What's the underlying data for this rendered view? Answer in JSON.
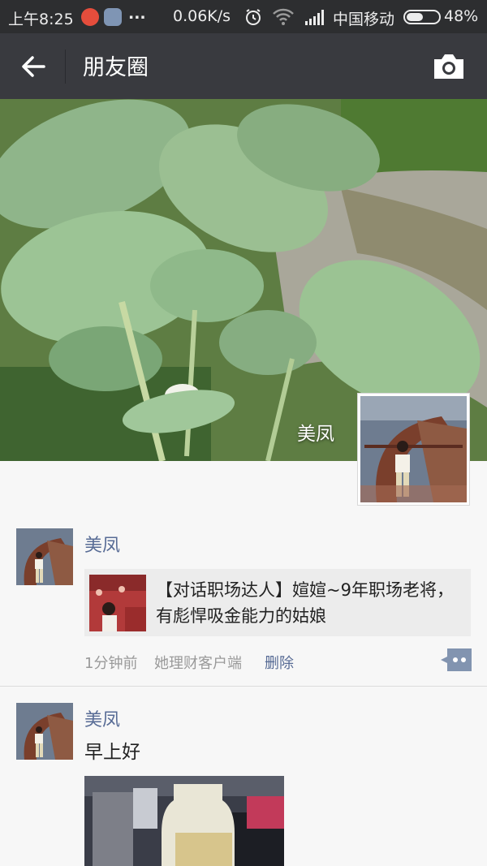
{
  "status_bar": {
    "time": "上午8:25",
    "dots": "...",
    "speed": "0.06K/s",
    "carrier": "中国移动",
    "battery": "48%",
    "icons": [
      "app-notification-icon",
      "contact-notification-icon",
      "alarm-icon",
      "wifi-icon",
      "signal-icon",
      "battery-icon"
    ]
  },
  "header": {
    "title": "朋友圈",
    "back_icon": "back-arrow-icon",
    "camera_icon": "camera-icon"
  },
  "cover": {
    "user_name": "美凤"
  },
  "posts": [
    {
      "name": "美凤",
      "share": {
        "title": "【对话职场达人】媗媗~9年职场老将，有彪悍吸金能力的姑娘"
      },
      "time": "1分钟前",
      "source": "她理财客户端",
      "delete_label": "删除"
    },
    {
      "name": "美凤",
      "text": "早上好"
    }
  ],
  "colors": {
    "status_bar": "#2d2e30",
    "nav_bar": "#393a3f",
    "name_link": "#576b95",
    "background": "#f7f7f7"
  }
}
